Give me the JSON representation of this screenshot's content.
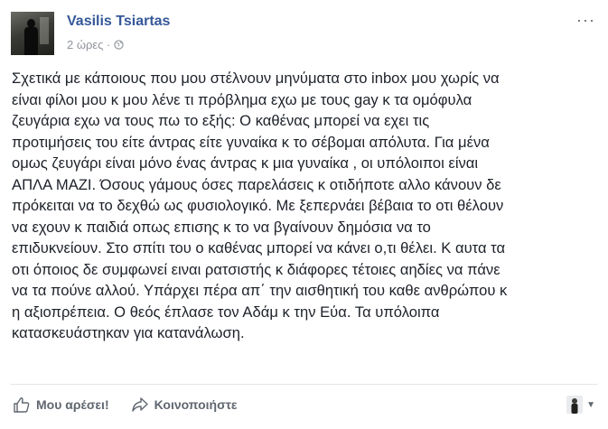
{
  "post": {
    "author": "Vasilis Tsiartas",
    "time": "2 ώρες ·",
    "more_label": "···",
    "lines": [
      "Σχετικά με κάποιους που μου στέλνουν μηνύματα στο inbox μου χωρίς να",
      "είναι φίλοι μου κ μου λένε τι πρόβλημα εχω με τους gay κ τα ομόφυλα",
      "ζευγάρια εχω να τους πω το εξής: Ο καθένας μπορεί να εχει τις",
      "προτιμήσεις του είτε άντρας είτε γυναίκα κ το σέβομαι απόλυτα. Για μένα",
      "ομως ζευγάρι είναι μόνο ένας άντρας κ μια γυναίκα , οι υπόλοιποι είναι",
      "ΑΠΛΑ ΜΑΖΙ. Όσους γάμους όσες παρελάσεις κ οτιδήποτε αλλο κάνουν δε",
      "πρόκειται να το δεχθώ ως φυσιολογικό. Με ξεπερνάει βέβαια το οτι θέλουν",
      "να εχουν κ παιδιά οπως επισης κ το να βγαίνουν δημόσια να το",
      "επιδυκνείουν. Στο σπίτι του ο καθένας μπορεί να κάνει ο,τι θέλει. Κ αυτα τα",
      "οτι όποιος δε συμφωνεί ειναι ρατσιστής κ διάφορες τέτοιες αηδίες να πάνε",
      "να τα πούνε αλλού. Υπάρχει πέρα απ΄ την αισθητική του καθε ανθρώπου κ",
      "η αξιοπρέπεια. Ο θεός έπλασε τον Αδάμ κ την Εύα. Τα υπόλοιπα",
      "κατασκευάστηκαν για κατανάλωση."
    ]
  },
  "actions": {
    "like_label": "Μου αρέσει!",
    "share_label": "Κοινοποιήστε"
  },
  "colors": {
    "author_link": "#365899",
    "muted": "#90949c",
    "action_text": "#606770"
  },
  "icons": {
    "like": "thumbs-up-icon",
    "share": "share-arrow-icon",
    "audience": "globe-icon",
    "more": "more-options-icon",
    "reaction_avatar": "profile-avatar-icon"
  }
}
